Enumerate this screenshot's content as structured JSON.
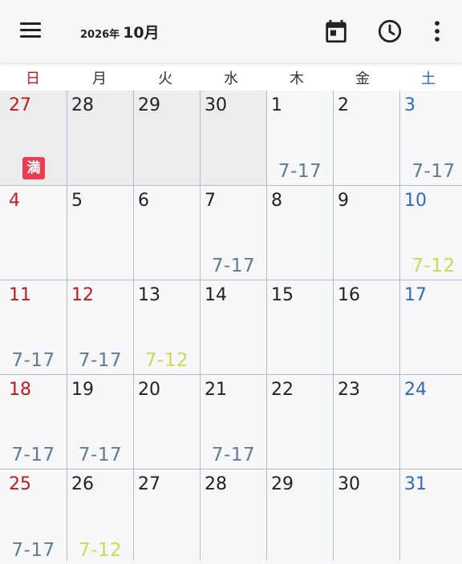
{
  "header": {
    "year_label": "2026年",
    "month_label": "10月",
    "icons": [
      "menu-icon",
      "calendar-today-icon",
      "clock-icon",
      "more-vert-icon"
    ]
  },
  "weekdays": [
    "日",
    "月",
    "火",
    "水",
    "木",
    "金",
    "土"
  ],
  "colors": {
    "sunday": "#c21b1f",
    "saturday": "#3469b4",
    "shift_7_17": "#607c8e",
    "shift_7_12": "#cfd84f",
    "badge": "#ea3d55"
  },
  "weeks": [
    [
      {
        "day": "27",
        "prev": true,
        "badge": "満"
      },
      {
        "day": "28",
        "prev": true
      },
      {
        "day": "29",
        "prev": true
      },
      {
        "day": "30",
        "prev": true
      },
      {
        "day": "1",
        "shift": "7-17",
        "kind": "a"
      },
      {
        "day": "2"
      },
      {
        "day": "3",
        "shift": "7-17",
        "kind": "a"
      }
    ],
    [
      {
        "day": "4"
      },
      {
        "day": "5"
      },
      {
        "day": "6"
      },
      {
        "day": "7",
        "shift": "7-17",
        "kind": "a"
      },
      {
        "day": "8"
      },
      {
        "day": "9"
      },
      {
        "day": "10",
        "shift": "7-12",
        "kind": "b"
      }
    ],
    [
      {
        "day": "11",
        "shift": "7-17",
        "kind": "a"
      },
      {
        "day": "12",
        "shift": "7-17",
        "kind": "a",
        "red": true
      },
      {
        "day": "13",
        "shift": "7-12",
        "kind": "b"
      },
      {
        "day": "14"
      },
      {
        "day": "15"
      },
      {
        "day": "16"
      },
      {
        "day": "17"
      }
    ],
    [
      {
        "day": "18",
        "shift": "7-17",
        "kind": "a"
      },
      {
        "day": "19",
        "shift": "7-17",
        "kind": "a"
      },
      {
        "day": "20"
      },
      {
        "day": "21",
        "shift": "7-17",
        "kind": "a"
      },
      {
        "day": "22"
      },
      {
        "day": "23"
      },
      {
        "day": "24"
      }
    ],
    [
      {
        "day": "25",
        "shift": "7-17",
        "kind": "a"
      },
      {
        "day": "26",
        "shift": "7-12",
        "kind": "b"
      },
      {
        "day": "27"
      },
      {
        "day": "28"
      },
      {
        "day": "29"
      },
      {
        "day": "30"
      },
      {
        "day": "31"
      }
    ]
  ]
}
